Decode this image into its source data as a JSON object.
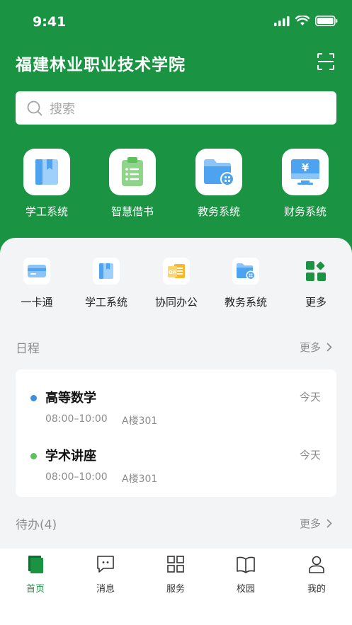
{
  "status_bar": {
    "time": "9:41"
  },
  "header": {
    "title": "福建林业职业技术学院"
  },
  "search": {
    "placeholder": "搜索"
  },
  "quick_actions": [
    {
      "label": "学工系统",
      "icon": "book-icon"
    },
    {
      "label": "智慧借书",
      "icon": "clipboard-list-icon"
    },
    {
      "label": "教务系统",
      "icon": "folder-grid-icon"
    },
    {
      "label": "财务系统",
      "icon": "monitor-yuan-icon"
    }
  ],
  "sub_actions": [
    {
      "label": "一卡通",
      "icon": "card-icon"
    },
    {
      "label": "学工系统",
      "icon": "book-icon"
    },
    {
      "label": "协同办公",
      "icon": "oa-document-icon"
    },
    {
      "label": "教务系统",
      "icon": "folder-grid-icon"
    },
    {
      "label": "更多",
      "icon": "apps-grid-icon"
    }
  ],
  "schedule": {
    "title": "日程",
    "more": "更多",
    "items": [
      {
        "title": "高等数学",
        "when": "今天",
        "time": "08:00–10:00",
        "room": "A楼301",
        "dot_color": "#3b8fe0"
      },
      {
        "title": "学术讲座",
        "when": "今天",
        "time": "08:00–10:00",
        "room": "A楼301",
        "dot_color": "#5cc15c"
      }
    ]
  },
  "todo": {
    "title": "待办(4)",
    "more": "更多"
  },
  "tabbar": {
    "items": [
      {
        "label": "首页",
        "icon": "home-icon",
        "active": true
      },
      {
        "label": "消息",
        "icon": "message-icon",
        "active": false
      },
      {
        "label": "服务",
        "icon": "grid-icon",
        "active": false
      },
      {
        "label": "校园",
        "icon": "open-book-icon",
        "active": false
      },
      {
        "label": "我的",
        "icon": "user-icon",
        "active": false
      }
    ]
  },
  "colors": {
    "brand": "#1a9442",
    "accent_blue": "#4ea3f0",
    "background": "#f3f4f6"
  }
}
